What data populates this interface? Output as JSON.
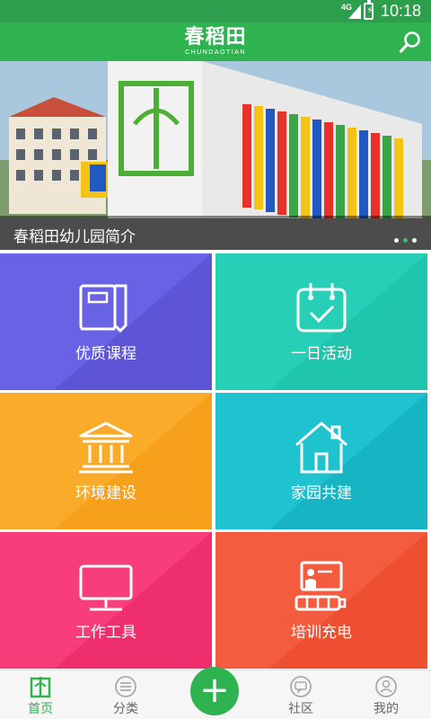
{
  "status_bar": {
    "network": "4G",
    "time": "10:18"
  },
  "app_bar": {
    "logo_cn": "春稻田",
    "logo_en": "CHUNDAOTIAN",
    "search_icon": "search-icon"
  },
  "banner": {
    "caption": "春稻田幼儿园简介",
    "slide_count": 3,
    "active_slide": 2
  },
  "tiles": [
    {
      "label": "优质课程",
      "icon": "book-icon",
      "color": "#6a62e4"
    },
    {
      "label": "一日活动",
      "icon": "calendar-check-icon",
      "color": "#27cfb7"
    },
    {
      "label": "环境建设",
      "icon": "building-icon",
      "color": "#fbab2a"
    },
    {
      "label": "家园共建",
      "icon": "house-icon",
      "color": "#1fc2cf"
    },
    {
      "label": "工作工具",
      "icon": "monitor-icon",
      "color": "#f73d7a"
    },
    {
      "label": "培训充电",
      "icon": "teacher-board-icon",
      "color": "#f45c3f"
    }
  ],
  "bottom_nav": {
    "items": [
      {
        "label": "首页",
        "icon": "home-logo-icon",
        "active": true
      },
      {
        "label": "分类",
        "icon": "category-icon",
        "active": false
      },
      {
        "label": "社区",
        "icon": "community-icon",
        "active": false
      },
      {
        "label": "我的",
        "icon": "profile-icon",
        "active": false
      }
    ],
    "center_button": "+"
  },
  "colors": {
    "primary": "#2fb351",
    "status_bar": "#2c9e4c"
  }
}
